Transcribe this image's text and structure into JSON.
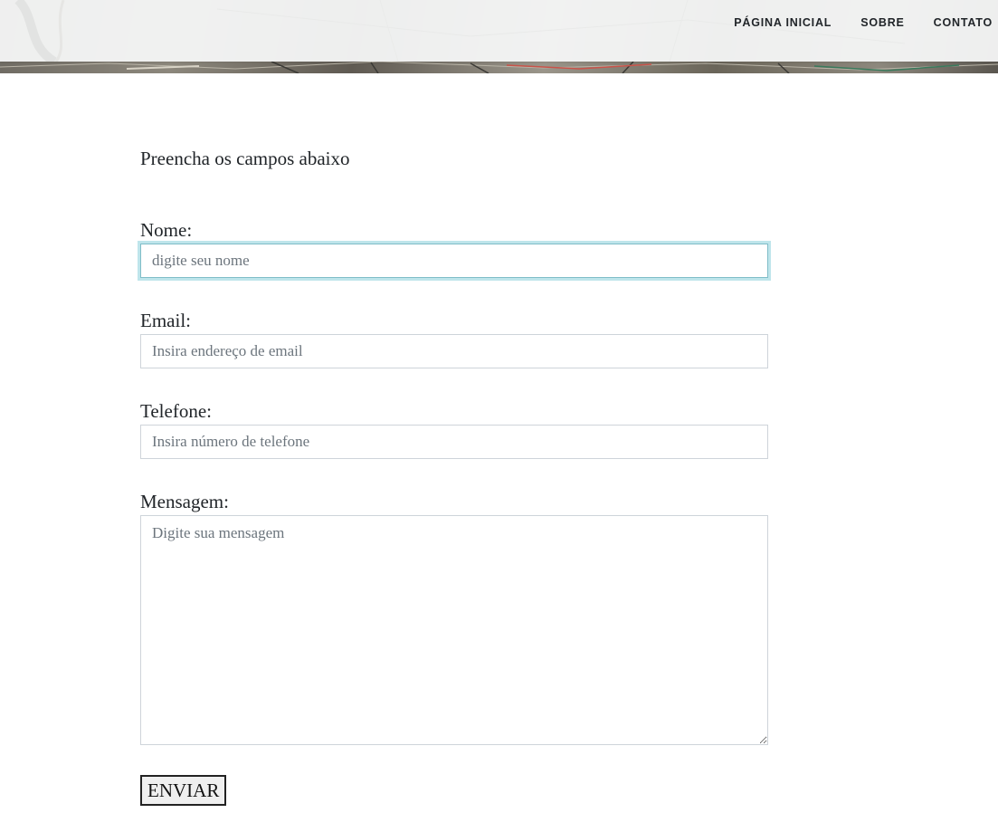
{
  "nav": {
    "links": [
      {
        "label": "PÁGINA INICIAL"
      },
      {
        "label": "SOBRE"
      },
      {
        "label": "CONTATO"
      }
    ]
  },
  "form": {
    "intro": "Preencha os campos abaixo",
    "fields": {
      "nome": {
        "label": "Nome:",
        "placeholder": "digite seu nome",
        "value": ""
      },
      "email": {
        "label": "Email:",
        "placeholder": "Insira endereço de email",
        "value": ""
      },
      "telefone": {
        "label": "Telefone:",
        "placeholder": "Insira número de telefone",
        "value": ""
      },
      "mensagem": {
        "label": "Mensagem:",
        "placeholder": "Digite sua mensagem",
        "value": ""
      }
    },
    "submit_label": "ENVIAR"
  },
  "colors": {
    "focus_ring": "#17a2b8",
    "input_border": "#ced4da",
    "text": "#212529",
    "placeholder": "#6c757d"
  },
  "icons": [
    "resize-handle-icon"
  ]
}
